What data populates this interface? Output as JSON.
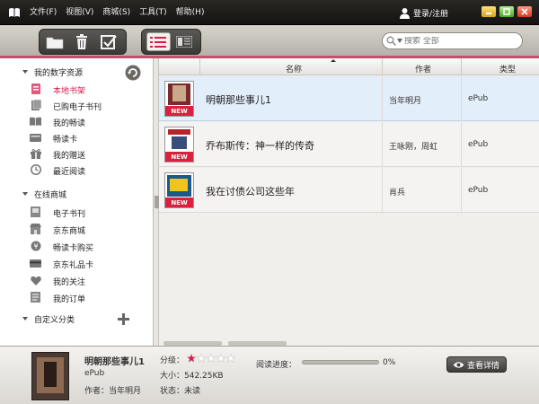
{
  "menu": [
    "文件(F)",
    "视图(V)",
    "商城(S)",
    "工具(T)",
    "帮助(H)"
  ],
  "account": {
    "login_label": "登录/注册"
  },
  "search": {
    "placeholder": "搜索 全部"
  },
  "sidebar": {
    "sections": [
      {
        "title": "我的数字资源",
        "items": [
          {
            "label": "本地书架",
            "icon": "bookshelf-icon",
            "selected": true
          },
          {
            "label": "已购电子书刊",
            "icon": "purchased-books-icon"
          },
          {
            "label": "我的畅读",
            "icon": "book-open-icon"
          },
          {
            "label": "畅读卡",
            "icon": "card-icon"
          },
          {
            "label": "我的赠送",
            "icon": "gift-icon"
          },
          {
            "label": "最近阅读",
            "icon": "clock-icon"
          }
        ]
      },
      {
        "title": "在线商城",
        "items": [
          {
            "label": "电子书刊",
            "icon": "ebook-icon"
          },
          {
            "label": "京东商城",
            "icon": "shop-icon"
          },
          {
            "label": "畅读卡购买",
            "icon": "buy-card-icon"
          },
          {
            "label": "京东礼品卡",
            "icon": "gift-card-icon"
          },
          {
            "label": "我的关注",
            "icon": "heart-icon"
          },
          {
            "label": "我的订单",
            "icon": "order-icon"
          }
        ]
      },
      {
        "title": "自定义分类",
        "items": []
      }
    ]
  },
  "table": {
    "columns": [
      "名称",
      "作者",
      "类型"
    ],
    "badge": "NEW",
    "rows": [
      {
        "title": "明朝那些事儿1",
        "author": "当年明月",
        "type": "ePub",
        "selected": true,
        "cover_color": "#7a2a2a"
      },
      {
        "title": "乔布斯传：神一样的传奇",
        "author": "王咏刚，周虹",
        "type": "ePub",
        "cover_color": "#e8e2d6"
      },
      {
        "title": "我在讨债公司这些年",
        "author": "肖兵",
        "type": "ePub",
        "cover_color": "#1a5a8a"
      }
    ]
  },
  "detail": {
    "title": "明朝那些事儿1",
    "type": "ePub",
    "author_label": "作者：当年明月",
    "rating_label": "分级：",
    "rating": 1,
    "rating_max": 5,
    "size_label": "大小：542.25KB",
    "status_label": "状态：未读",
    "progress_label": "阅读进度：",
    "progress_value": 0,
    "progress_text": "0%",
    "details_button": "查看详情"
  },
  "colors": {
    "accent": "#c5506e",
    "selected_text": "#d31e4e",
    "selected_row": "#e2eef9",
    "badge": "#d9203c"
  }
}
